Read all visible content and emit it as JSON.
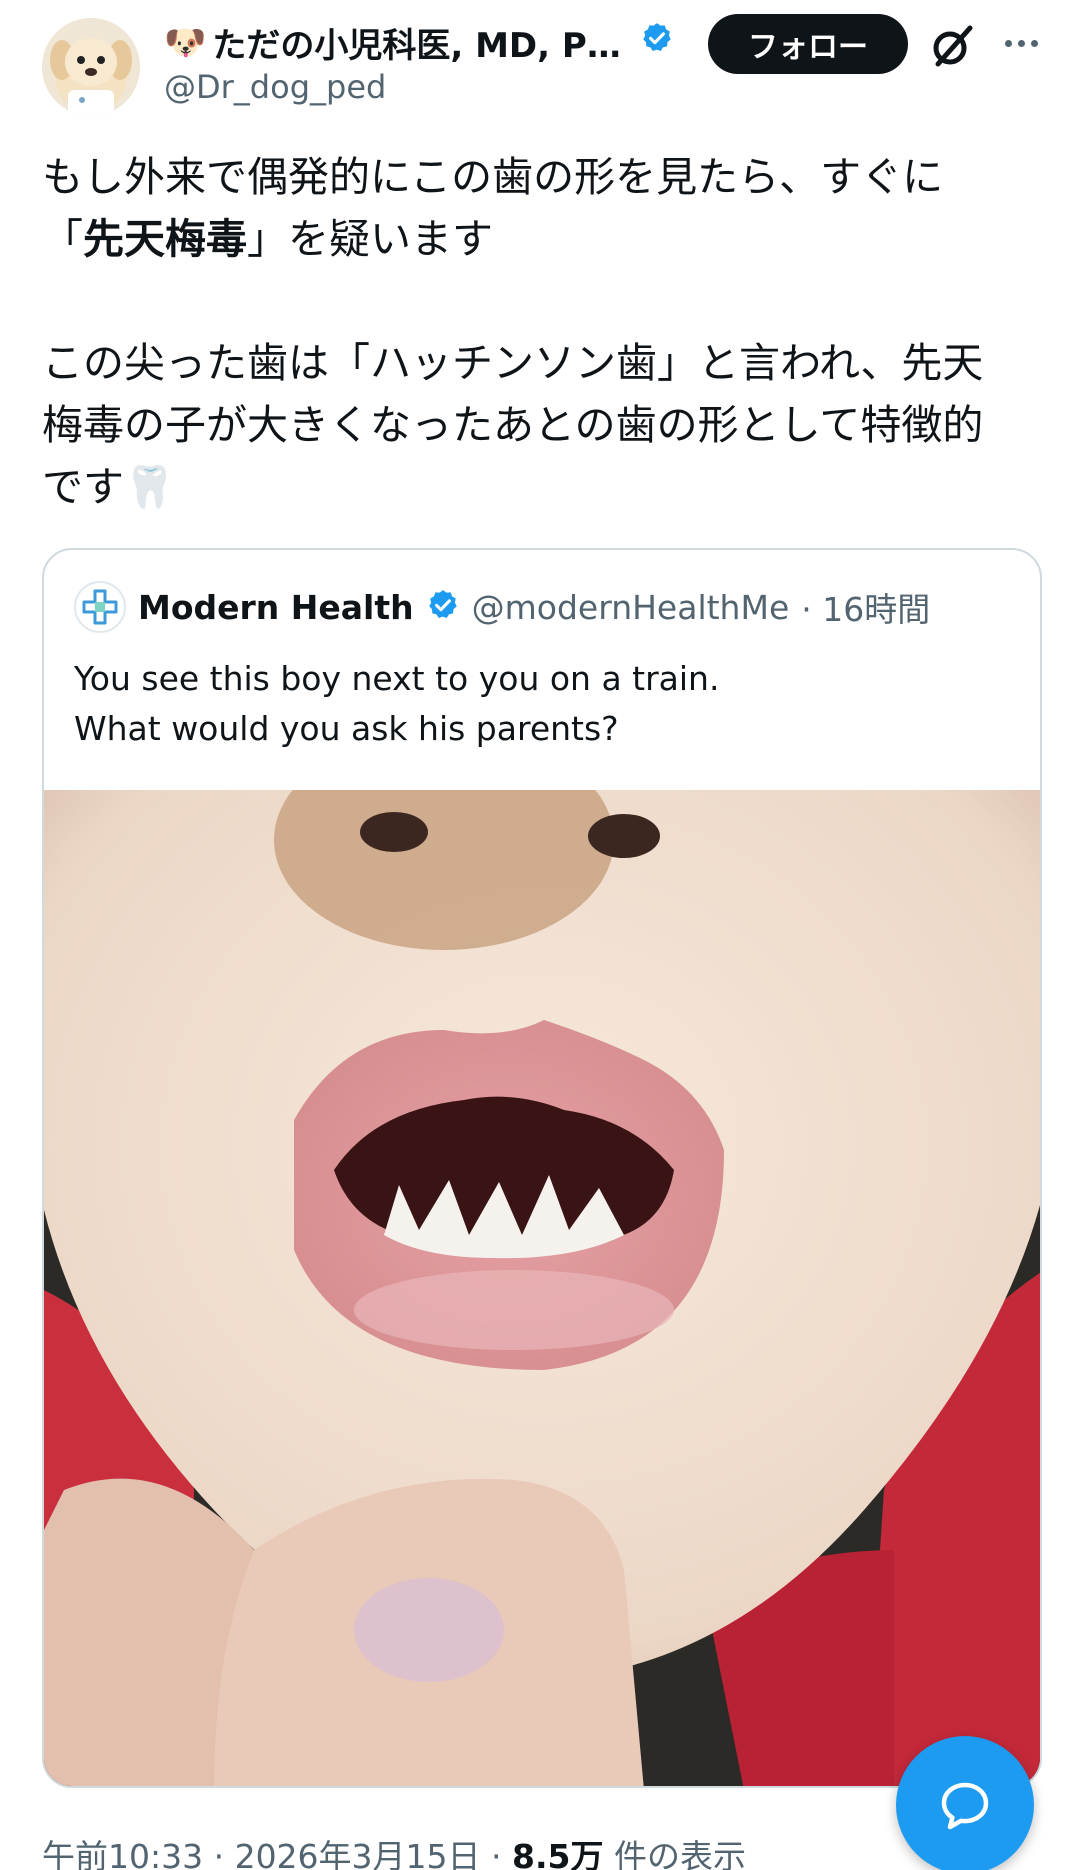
{
  "author": {
    "emoji": "🐶",
    "name": "ただの小児科医, MD, Ph...",
    "verified": true,
    "handle": "@Dr_dog_ped"
  },
  "header": {
    "follow_label": "フォロー",
    "grok_icon": "grok-slash-icon",
    "more_icon": "more-dots-icon"
  },
  "tweet": {
    "line1": "もし外来で偶発的にこの歯の形を見たら、すぐに",
    "line2_open": "「",
    "line2_bold": "先天梅毒",
    "line2_rest": "」を疑います",
    "line3": "この尖った歯は「ハッチンソン歯」と言われ、先天",
    "line4": "梅毒の子が大きくなったあとの歯の形として特徴的",
    "line5": "です",
    "line5_emoji": "🦷"
  },
  "quote": {
    "name": "Modern Health",
    "verified": true,
    "handle": "@modernHealthMe",
    "time": "· 16時間",
    "line1": "You see this boy next to you on a train.",
    "line2": "What would you ask his parents?"
  },
  "meta": {
    "time": "午前10:33 · 2026年3月15日 · ",
    "views": "8.5万",
    "views_label": " 件の表示"
  },
  "colors": {
    "accent": "#1d9bf0",
    "text": "#0f1419",
    "secondary": "#536471",
    "border": "#cfd9de"
  }
}
